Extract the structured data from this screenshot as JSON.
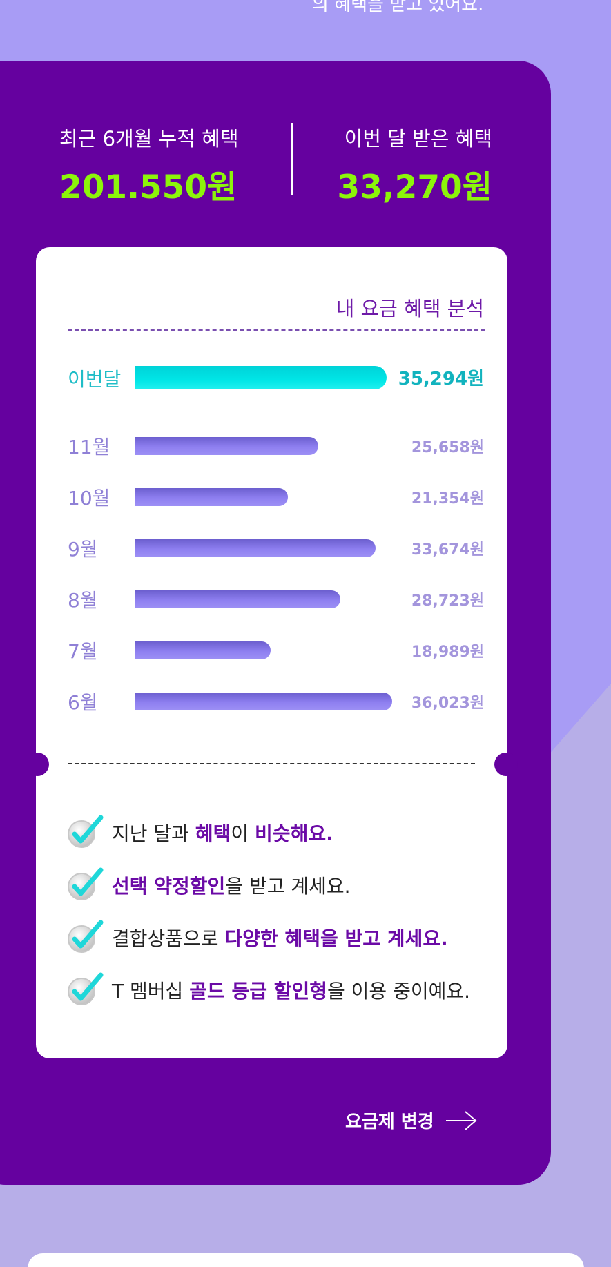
{
  "intro": {
    "text_partial": "의 혜택을 받고 있어요."
  },
  "summary": {
    "cumulative_label": "최근 6개월 누적 혜택",
    "cumulative_value": "201.550원",
    "this_month_label": "이번 달 받은 혜택",
    "this_month_value": "33,270원"
  },
  "analysis": {
    "title": "내 요금 혜택 분석",
    "max_value": 36023,
    "bars": [
      {
        "label": "이번달",
        "value": 35294,
        "value_text": "35,294원",
        "current": true
      },
      {
        "label": "11월",
        "value": 25658,
        "value_text": "25,658원",
        "current": false
      },
      {
        "label": "10월",
        "value": 21354,
        "value_text": "21,354원",
        "current": false
      },
      {
        "label": "9월",
        "value": 33674,
        "value_text": "33,674원",
        "current": false
      },
      {
        "label": "8월",
        "value": 28723,
        "value_text": "28,723원",
        "current": false
      },
      {
        "label": "7월",
        "value": 18989,
        "value_text": "18,989원",
        "current": false
      },
      {
        "label": "6월",
        "value": 36023,
        "value_text": "36,023원",
        "current": false
      }
    ]
  },
  "checklist": [
    {
      "parts": [
        {
          "t": "지난 달과 ",
          "b": false
        },
        {
          "t": "혜택",
          "b": true
        },
        {
          "t": "이 ",
          "b": false
        },
        {
          "t": "비슷해요.",
          "b": true
        }
      ]
    },
    {
      "parts": [
        {
          "t": "선택 약정할인",
          "b": true
        },
        {
          "t": "을 받고 계세요.",
          "b": false
        }
      ]
    },
    {
      "parts": [
        {
          "t": "결합상품으로 ",
          "b": false
        },
        {
          "t": "다양한 혜택을 받고 계세요.",
          "b": true
        }
      ]
    },
    {
      "parts": [
        {
          "t": "T 멤버십 ",
          "b": false
        },
        {
          "t": "골드 등급 할인형",
          "b": true
        },
        {
          "t": "을 이용 중이예요.",
          "b": false
        }
      ]
    }
  ],
  "actions": {
    "change_plan_label": "요금제 변경"
  },
  "colors": {
    "background": "#a89cf5",
    "card": "#65019f",
    "highlight_value": "#8cf50a",
    "current_bar": "#00e6e6",
    "month_bar": "#8e7ff0",
    "emphasis_text": "#6b0aa6"
  },
  "icons": {
    "check": "check-icon",
    "arrow": "arrow-right-icon"
  }
}
